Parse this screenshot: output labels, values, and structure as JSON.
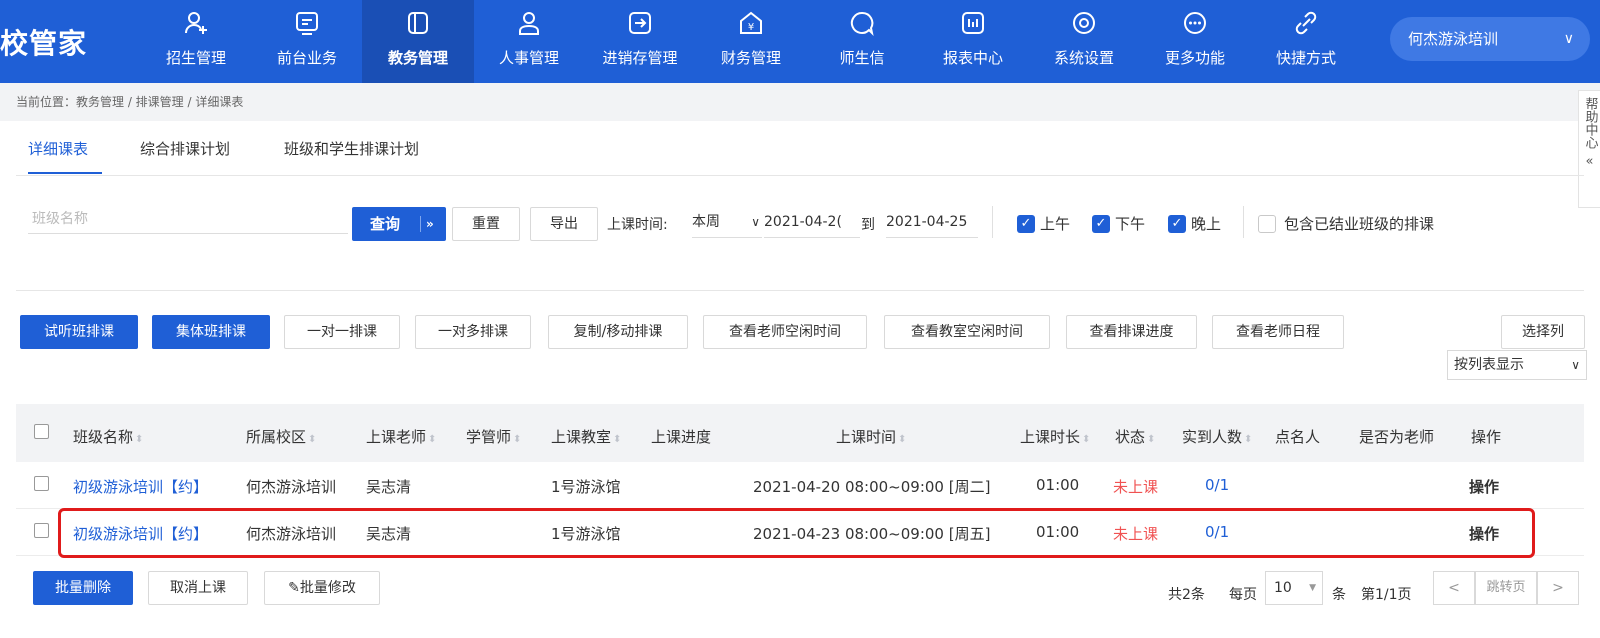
{
  "brand": "校管家",
  "nav": [
    {
      "label": "招生管理",
      "icon": "user-add-icon"
    },
    {
      "label": "前台业务",
      "icon": "monitor-icon"
    },
    {
      "label": "教务管理",
      "icon": "book-icon"
    },
    {
      "label": "人事管理",
      "icon": "person-icon"
    },
    {
      "label": "进销存管理",
      "icon": "box-arrow-icon"
    },
    {
      "label": "财务管理",
      "icon": "money-house-icon"
    },
    {
      "label": "师生信",
      "icon": "chat-icon"
    },
    {
      "label": "报表中心",
      "icon": "report-icon"
    },
    {
      "label": "系统设置",
      "icon": "settings-icon"
    },
    {
      "label": "更多功能",
      "icon": "more-icon"
    },
    {
      "label": "快捷方式",
      "icon": "link-icon"
    }
  ],
  "campus": "何杰游泳培训",
  "breadcrumb": "当前位置：教务管理 / 排课管理 / 详细课表",
  "help": "帮助中心",
  "help_toggle": "«",
  "tabs": [
    "详细课表",
    "综合排课计划",
    "班级和学生排课计划"
  ],
  "filters": {
    "class_placeholder": "班级名称",
    "query": "查询",
    "reset": "重置",
    "export": "导出",
    "time_label": "上课时间:",
    "range": "本周",
    "start_date": "2021-04-2(",
    "to": "到",
    "end_date": "2021-04-25",
    "morning": "上午",
    "afternoon": "下午",
    "evening": "晚上",
    "include_closed": "包含已结业班级的排课"
  },
  "actions": [
    "试听班排课",
    "集体班排课",
    "一对一排课",
    "一对多排课",
    "复制/移动排课",
    "查看老师空闲时间",
    "查看教室空闲时间",
    "查看排课进度",
    "查看老师日程"
  ],
  "select_columns": "选择列",
  "view_mode": "按列表显示",
  "columns": [
    "班级名称",
    "所属校区",
    "上课老师",
    "学管师",
    "上课教室",
    "上课进度",
    "上课时间",
    "上课时长",
    "状态",
    "实到人数",
    "点名人",
    "是否为老师",
    "操作"
  ],
  "rows": [
    {
      "class": "初级游泳培训【约】",
      "campus": "何杰游泳培训",
      "teacher": "吴志清",
      "room": "1号游泳馆",
      "time": "2021-04-20 08:00~09:00 [周二]",
      "duration": "01:00",
      "status": "未上课",
      "attendance": "0/1",
      "op": "操作"
    },
    {
      "class": "初级游泳培训【约】",
      "campus": "何杰游泳培训",
      "teacher": "吴志清",
      "room": "1号游泳馆",
      "time": "2021-04-23 08:00~09:00 [周五]",
      "duration": "01:00",
      "status": "未上课",
      "attendance": "0/1",
      "op": "操作"
    }
  ],
  "footer": {
    "batch_delete": "批量删除",
    "cancel": "取消上课",
    "batch_edit": "批量修改",
    "total": "共2条",
    "per_page_label": "每页",
    "per_page": "10",
    "unit": "条",
    "page_info": "第1/1页",
    "jump": "跳转页"
  },
  "colors": {
    "primary": "#1f5fd6",
    "status_red": "#f05252",
    "highlight": "#e01b1b"
  }
}
